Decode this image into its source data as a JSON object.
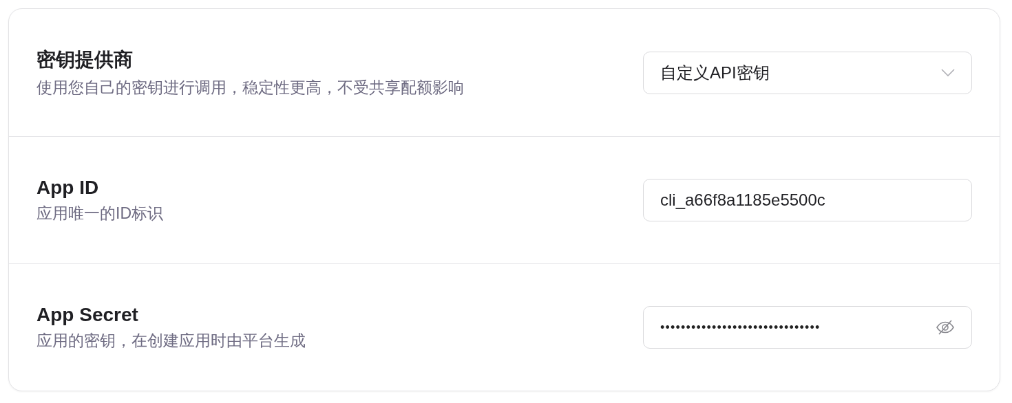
{
  "settings": [
    {
      "kind": "select",
      "label": "密钥提供商",
      "description": "使用您自己的密钥进行调用，稳定性更高，不受共享配额影响",
      "value": "自定义API密钥"
    },
    {
      "kind": "text",
      "label": "App ID",
      "description": "应用唯一的ID标识",
      "value": "cli_a66f8a1185e5500c"
    },
    {
      "kind": "password",
      "label": "App Secret",
      "description": "应用的密钥，在创建应用时由平台生成",
      "value": "•••••••••••••••••••••••••••••••",
      "revealed": false
    }
  ]
}
